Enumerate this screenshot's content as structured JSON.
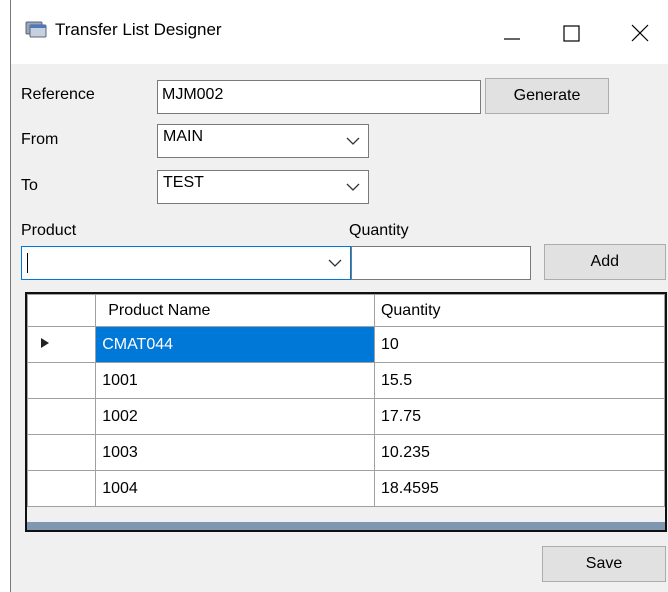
{
  "window": {
    "title": "Transfer List Designer",
    "icon": "app-window-icon",
    "controls": [
      "minimize-icon",
      "maximize-icon",
      "close-icon"
    ]
  },
  "form": {
    "reference_label": "Reference",
    "reference_value": "MJM002",
    "generate_label": "Generate",
    "from_label": "From",
    "from_value": "MAIN",
    "to_label": "To",
    "to_value": "TEST",
    "product_label": "Product",
    "product_value": "",
    "quantity_label": "Quantity",
    "quantity_value": "",
    "add_label": "Add",
    "save_label": "Save"
  },
  "grid": {
    "columns": [
      "Product Name",
      "Quantity"
    ],
    "rows": [
      {
        "name": "CMAT044",
        "qty": "10",
        "selected": true
      },
      {
        "name": "1001",
        "qty": "15.5"
      },
      {
        "name": "1002",
        "qty": "17.75"
      },
      {
        "name": "1003",
        "qty": "10.235"
      },
      {
        "name": "1004",
        "qty": "18.4595"
      }
    ],
    "selection_color": "#0078d7"
  }
}
